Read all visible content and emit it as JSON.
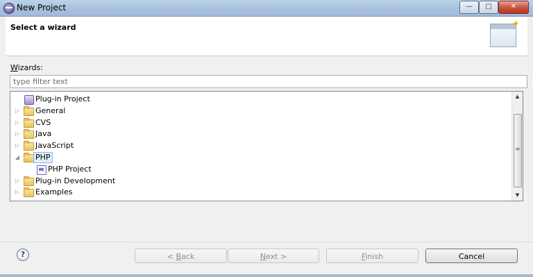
{
  "window": {
    "title": "New Project",
    "controls": {
      "minimize": "—",
      "maximize": "□",
      "close": "✕"
    }
  },
  "banner": {
    "title": "Select a wizard",
    "icon": "wizard-banner-icon"
  },
  "wizards": {
    "label_mnemonic": "W",
    "label_rest": "izards:",
    "filter_placeholder": "type filter text",
    "tree": [
      {
        "label": "Plug-in Project",
        "icon": "plugin-project-icon",
        "expanded": null,
        "level": 0
      },
      {
        "label": "General",
        "icon": "folder-icon",
        "expanded": false,
        "level": 0
      },
      {
        "label": "CVS",
        "icon": "folder-icon",
        "expanded": false,
        "level": 0
      },
      {
        "label": "Java",
        "icon": "folder-icon",
        "expanded": false,
        "level": 0
      },
      {
        "label": "JavaScript",
        "icon": "folder-icon",
        "expanded": false,
        "level": 0
      },
      {
        "label": "PHP",
        "icon": "folder-icon",
        "expanded": true,
        "level": 0,
        "selected": true
      },
      {
        "label": "PHP Project",
        "icon": "php-project-icon",
        "expanded": null,
        "level": 1
      },
      {
        "label": "Plug-in Development",
        "icon": "folder-icon",
        "expanded": false,
        "level": 0
      },
      {
        "label": "Examples",
        "icon": "folder-icon",
        "expanded": false,
        "level": 0
      }
    ],
    "twisty_collapsed": "▷",
    "twisty_expanded": "◢"
  },
  "footer": {
    "help": "?",
    "back": {
      "prefix": "< ",
      "mnemonic": "B",
      "rest": "ack",
      "enabled": false
    },
    "next": {
      "mnemonic": "N",
      "rest": "ext >",
      "enabled": false
    },
    "finish": {
      "mnemonic": "F",
      "rest": "inish",
      "enabled": false
    },
    "cancel": {
      "label": "Cancel",
      "enabled": true
    }
  },
  "colors": {
    "selection_bg": "#ddeeff",
    "selection_border": "#8fb4e0",
    "title_bar": "#a9c3df"
  }
}
